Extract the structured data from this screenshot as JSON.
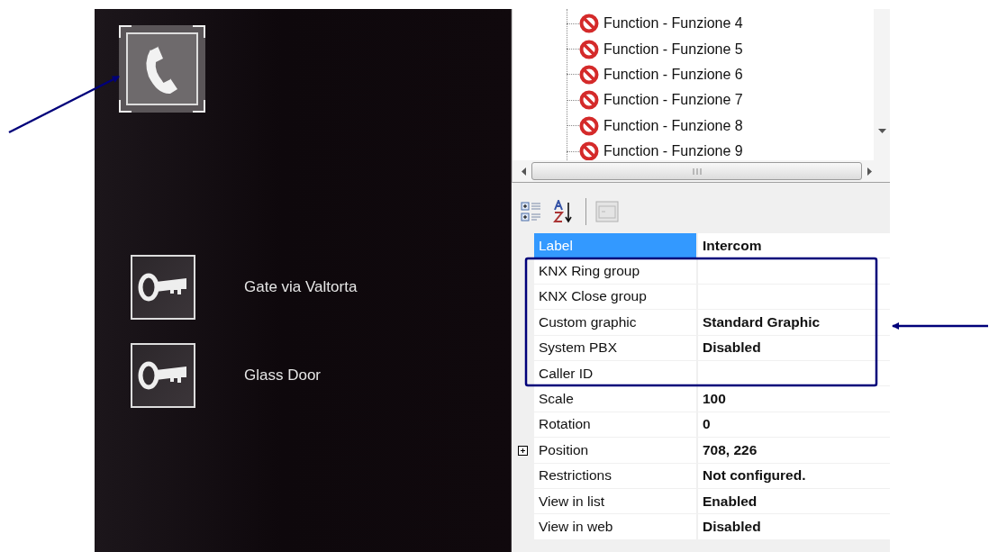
{
  "device_panel": {
    "intercom": {
      "selected": true
    },
    "items": [
      {
        "label": "Gate via Valtorta"
      },
      {
        "label": "Glass Door"
      }
    ]
  },
  "tree": {
    "items": [
      {
        "label": "Function - Funzione 4"
      },
      {
        "label": "Function - Funzione 5"
      },
      {
        "label": "Function - Funzione 6"
      },
      {
        "label": "Function - Funzione 7"
      },
      {
        "label": "Function - Funzione 8"
      },
      {
        "label": "Function - Funzione 9"
      }
    ]
  },
  "properties": {
    "rows": [
      {
        "name": "Label",
        "value": "Intercom",
        "selected": true,
        "expandable": false
      },
      {
        "name": "KNX Ring group",
        "value": "",
        "selected": false,
        "expandable": false
      },
      {
        "name": "KNX Close group",
        "value": "",
        "selected": false,
        "expandable": false
      },
      {
        "name": "Custom graphic",
        "value": "Standard Graphic",
        "selected": false,
        "expandable": false
      },
      {
        "name": "System PBX",
        "value": "Disabled",
        "selected": false,
        "expandable": false
      },
      {
        "name": "Caller ID",
        "value": "",
        "selected": false,
        "expandable": false
      },
      {
        "name": "Scale",
        "value": "100",
        "selected": false,
        "expandable": false
      },
      {
        "name": "Rotation",
        "value": "0",
        "selected": false,
        "expandable": false
      },
      {
        "name": "Position",
        "value": "708, 226",
        "selected": false,
        "expandable": true
      },
      {
        "name": "Restrictions",
        "value": "Not configured.",
        "selected": false,
        "expandable": false
      },
      {
        "name": "View in list",
        "value": "Enabled",
        "selected": false,
        "expandable": false
      },
      {
        "name": "View in web",
        "value": "Disabled",
        "selected": false,
        "expandable": false
      }
    ]
  }
}
